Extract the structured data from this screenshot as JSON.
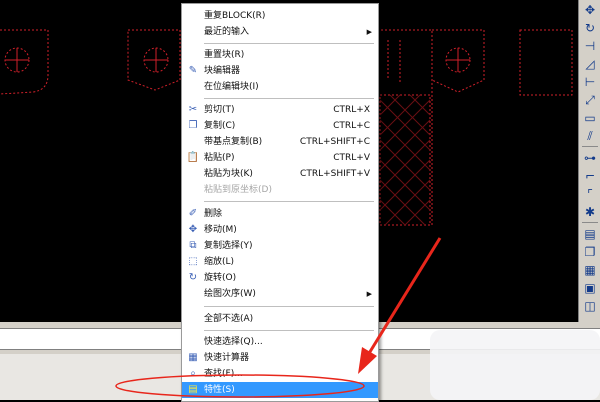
{
  "menu": {
    "items": [
      {
        "label": "重复BLOCK(R)",
        "icon": "",
        "shortcut": "",
        "submenu": false,
        "disabled": false
      },
      {
        "label": "最近的输入",
        "icon": "",
        "shortcut": "",
        "submenu": true,
        "disabled": false
      },
      {
        "label": "重置块(R)",
        "icon": "",
        "shortcut": "",
        "submenu": false,
        "disabled": false
      },
      {
        "label": "块编辑器",
        "icon": "block-editor-icon",
        "shortcut": "",
        "submenu": false,
        "disabled": false
      },
      {
        "label": "在位编辑块(I)",
        "icon": "",
        "shortcut": "",
        "submenu": false,
        "disabled": false
      },
      {
        "label": "剪切(T)",
        "icon": "scissors-icon",
        "shortcut": "CTRL+X",
        "submenu": false,
        "disabled": false
      },
      {
        "label": "复制(C)",
        "icon": "copy-icon",
        "shortcut": "CTRL+C",
        "submenu": false,
        "disabled": false
      },
      {
        "label": "带基点复制(B)",
        "icon": "",
        "shortcut": "CTRL+SHIFT+C",
        "submenu": false,
        "disabled": false
      },
      {
        "label": "粘贴(P)",
        "icon": "paste-icon",
        "shortcut": "CTRL+V",
        "submenu": false,
        "disabled": false
      },
      {
        "label": "粘贴为块(K)",
        "icon": "",
        "shortcut": "CTRL+SHIFT+V",
        "submenu": false,
        "disabled": false
      },
      {
        "label": "粘贴到原坐标(D)",
        "icon": "",
        "shortcut": "",
        "submenu": false,
        "disabled": true
      },
      {
        "label": "删除",
        "icon": "eraser-icon",
        "shortcut": "",
        "submenu": false,
        "disabled": false
      },
      {
        "label": "移动(M)",
        "icon": "move-icon",
        "shortcut": "",
        "submenu": false,
        "disabled": false
      },
      {
        "label": "复制选择(Y)",
        "icon": "copy-selection-icon",
        "shortcut": "",
        "submenu": false,
        "disabled": false
      },
      {
        "label": "缩放(L)",
        "icon": "scale-icon",
        "shortcut": "",
        "submenu": false,
        "disabled": false
      },
      {
        "label": "旋转(O)",
        "icon": "rotate-icon",
        "shortcut": "",
        "submenu": false,
        "disabled": false
      },
      {
        "label": "绘图次序(W)",
        "icon": "",
        "shortcut": "",
        "submenu": true,
        "disabled": false
      },
      {
        "label": "全部不选(A)",
        "icon": "",
        "shortcut": "",
        "submenu": false,
        "disabled": false
      },
      {
        "label": "快速选择(Q)...",
        "icon": "",
        "shortcut": "",
        "submenu": false,
        "disabled": false
      },
      {
        "label": "快速计算器",
        "icon": "calculator-icon",
        "shortcut": "",
        "submenu": false,
        "disabled": false
      },
      {
        "label": "查找(F)...",
        "icon": "find-icon",
        "shortcut": "",
        "submenu": false,
        "disabled": false
      },
      {
        "label": "特性(S)",
        "icon": "properties-icon",
        "shortcut": "",
        "submenu": false,
        "disabled": false,
        "highlighted": true
      }
    ]
  },
  "colors": {
    "canvas": "#000000",
    "drawing": "#d0202a",
    "menu_highlight": "#3399ff",
    "annotation": "#e8261b",
    "toolbar_icon": "#123a8a"
  },
  "toolbar": {
    "icons": [
      "move-icon",
      "rotate-icon",
      "trim-icon",
      "mirror-icon",
      "extend-icon",
      "scale-icon",
      "rectangle-icon",
      "offset-icon",
      "line-icon",
      "break-icon",
      "fillet-icon",
      "chamfer-icon",
      "explode-icon",
      "layer-icon",
      "copy-icon",
      "properties-icon",
      "array-icon",
      "group-icon"
    ]
  }
}
